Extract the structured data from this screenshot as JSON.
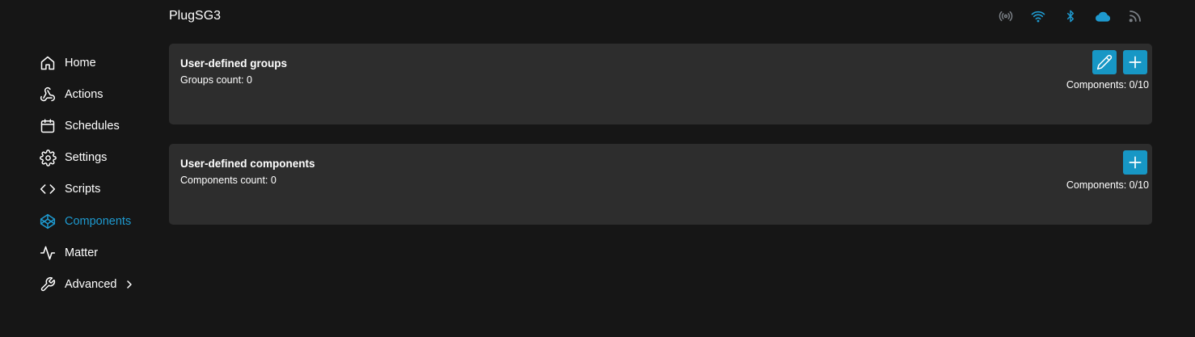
{
  "header": {
    "device_name": "PlugSG3",
    "status_icons": [
      {
        "name": "radio-icon",
        "color": "#7a7f85"
      },
      {
        "name": "wifi-icon",
        "color": "#1e9ad0"
      },
      {
        "name": "bluetooth-icon",
        "color": "#1e9ad0"
      },
      {
        "name": "cloud-icon",
        "color": "#1e9ad0"
      },
      {
        "name": "rss-icon",
        "color": "#7a7f85"
      }
    ]
  },
  "sidebar": {
    "items": [
      {
        "label": "Home",
        "icon": "home-icon"
      },
      {
        "label": "Actions",
        "icon": "webhook-icon"
      },
      {
        "label": "Schedules",
        "icon": "calendar-icon"
      },
      {
        "label": "Settings",
        "icon": "gear-icon"
      },
      {
        "label": "Scripts",
        "icon": "code-icon"
      },
      {
        "label": "Components",
        "icon": "codepen-icon",
        "active": true
      },
      {
        "label": "Matter",
        "icon": "activity-icon"
      },
      {
        "label": "Advanced",
        "icon": "wrench-icon",
        "has_chevron": true
      }
    ]
  },
  "groups_card": {
    "title": "User-defined groups",
    "subtitle": "Groups count: 0",
    "components_count": "Components: 0/10",
    "actions": [
      "edit-icon",
      "plus-icon"
    ]
  },
  "components_card": {
    "title": "User-defined components",
    "subtitle": "Components count: 0",
    "components_count": "Components: 0/10",
    "actions": [
      "plus-icon"
    ]
  },
  "colors": {
    "background": "#161616",
    "card": "#2d2d2d",
    "accent": "#1e9ad0",
    "button": "#1797c5",
    "muted_icon": "#7a7f85"
  }
}
